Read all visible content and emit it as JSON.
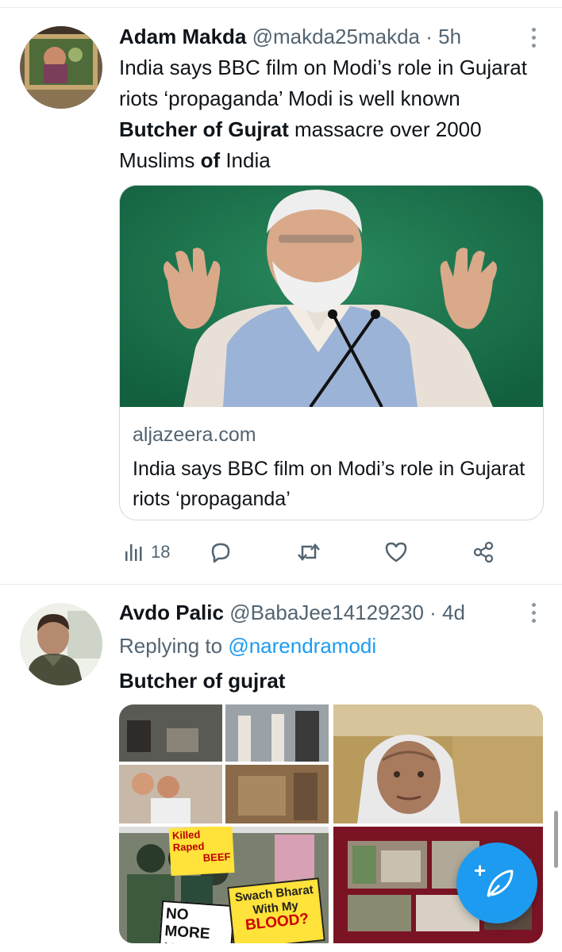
{
  "tweets": [
    {
      "author_name": "Adam Makda",
      "handle": "@makda25makda",
      "separator": "·",
      "time": "5h",
      "text_parts": [
        {
          "t": "India says BBC film on Modi’s role in Gujarat riots ‘propaganda’ Modi is well known ",
          "bold": false
        },
        {
          "t": "Butcher of Gujrat",
          "bold": true
        },
        {
          "t": " massacre over 2000 Muslims ",
          "bold": false
        },
        {
          "t": "of",
          "bold": true
        },
        {
          "t": " India",
          "bold": false
        }
      ],
      "card": {
        "domain": "aljazeera.com",
        "title": "India says BBC film on Modi’s role in Gujarat riots ‘propaganda’"
      },
      "actions": {
        "views_count": "18",
        "icons": [
          "views-icon",
          "reply-icon",
          "retweet-icon",
          "like-icon",
          "share-icon"
        ]
      }
    },
    {
      "author_name": "Avdo Palic",
      "handle": "@BabaJee14129230",
      "separator": "·",
      "time": "4d",
      "replying_prefix": "Replying to",
      "replying_handle": "@narendramodi",
      "text": "Butcher of gujrat",
      "grid_signs": {
        "sign1_l1": "Killed",
        "sign1_l2": "Raped",
        "sign1_l3": "BEEF",
        "sign2": "NO MORE KILLING",
        "sign3_l1": "Swach Bharat",
        "sign3_l2": "With My",
        "sign3_l3": "BLOOD?"
      }
    }
  ],
  "fab": {
    "icon": "compose-tweet-icon",
    "plus": "+"
  },
  "colors": {
    "accent": "#1d9bf0",
    "muted": "#536471",
    "text": "#0f1419",
    "border": "#cfd9de"
  }
}
